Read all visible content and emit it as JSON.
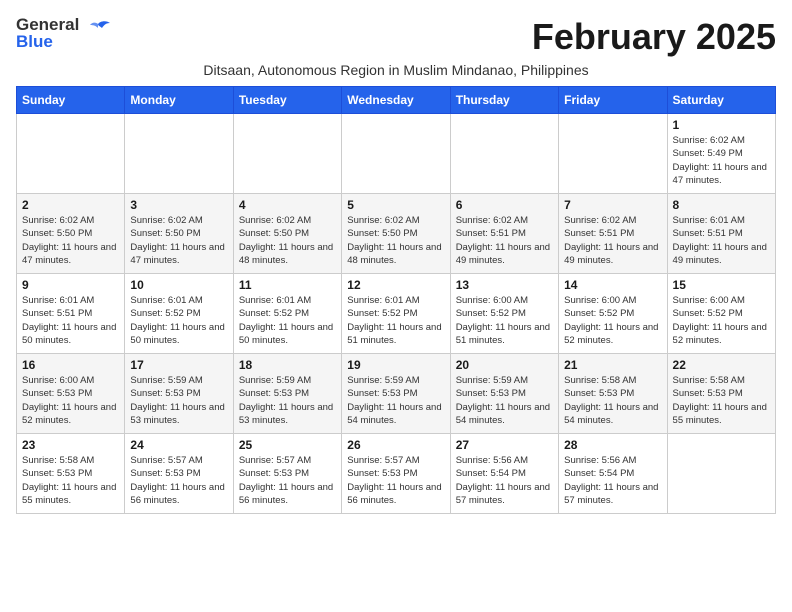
{
  "header": {
    "logo_general": "General",
    "logo_blue": "Blue",
    "month_title": "February 2025",
    "location": "Ditsaan, Autonomous Region in Muslim Mindanao, Philippines"
  },
  "days_of_week": [
    "Sunday",
    "Monday",
    "Tuesday",
    "Wednesday",
    "Thursday",
    "Friday",
    "Saturday"
  ],
  "weeks": [
    [
      {
        "day": "",
        "info": ""
      },
      {
        "day": "",
        "info": ""
      },
      {
        "day": "",
        "info": ""
      },
      {
        "day": "",
        "info": ""
      },
      {
        "day": "",
        "info": ""
      },
      {
        "day": "",
        "info": ""
      },
      {
        "day": "1",
        "info": "Sunrise: 6:02 AM\nSunset: 5:49 PM\nDaylight: 11 hours and 47 minutes."
      }
    ],
    [
      {
        "day": "2",
        "info": "Sunrise: 6:02 AM\nSunset: 5:50 PM\nDaylight: 11 hours and 47 minutes."
      },
      {
        "day": "3",
        "info": "Sunrise: 6:02 AM\nSunset: 5:50 PM\nDaylight: 11 hours and 47 minutes."
      },
      {
        "day": "4",
        "info": "Sunrise: 6:02 AM\nSunset: 5:50 PM\nDaylight: 11 hours and 48 minutes."
      },
      {
        "day": "5",
        "info": "Sunrise: 6:02 AM\nSunset: 5:50 PM\nDaylight: 11 hours and 48 minutes."
      },
      {
        "day": "6",
        "info": "Sunrise: 6:02 AM\nSunset: 5:51 PM\nDaylight: 11 hours and 49 minutes."
      },
      {
        "day": "7",
        "info": "Sunrise: 6:02 AM\nSunset: 5:51 PM\nDaylight: 11 hours and 49 minutes."
      },
      {
        "day": "8",
        "info": "Sunrise: 6:01 AM\nSunset: 5:51 PM\nDaylight: 11 hours and 49 minutes."
      }
    ],
    [
      {
        "day": "9",
        "info": "Sunrise: 6:01 AM\nSunset: 5:51 PM\nDaylight: 11 hours and 50 minutes."
      },
      {
        "day": "10",
        "info": "Sunrise: 6:01 AM\nSunset: 5:52 PM\nDaylight: 11 hours and 50 minutes."
      },
      {
        "day": "11",
        "info": "Sunrise: 6:01 AM\nSunset: 5:52 PM\nDaylight: 11 hours and 50 minutes."
      },
      {
        "day": "12",
        "info": "Sunrise: 6:01 AM\nSunset: 5:52 PM\nDaylight: 11 hours and 51 minutes."
      },
      {
        "day": "13",
        "info": "Sunrise: 6:00 AM\nSunset: 5:52 PM\nDaylight: 11 hours and 51 minutes."
      },
      {
        "day": "14",
        "info": "Sunrise: 6:00 AM\nSunset: 5:52 PM\nDaylight: 11 hours and 52 minutes."
      },
      {
        "day": "15",
        "info": "Sunrise: 6:00 AM\nSunset: 5:52 PM\nDaylight: 11 hours and 52 minutes."
      }
    ],
    [
      {
        "day": "16",
        "info": "Sunrise: 6:00 AM\nSunset: 5:53 PM\nDaylight: 11 hours and 52 minutes."
      },
      {
        "day": "17",
        "info": "Sunrise: 5:59 AM\nSunset: 5:53 PM\nDaylight: 11 hours and 53 minutes."
      },
      {
        "day": "18",
        "info": "Sunrise: 5:59 AM\nSunset: 5:53 PM\nDaylight: 11 hours and 53 minutes."
      },
      {
        "day": "19",
        "info": "Sunrise: 5:59 AM\nSunset: 5:53 PM\nDaylight: 11 hours and 54 minutes."
      },
      {
        "day": "20",
        "info": "Sunrise: 5:59 AM\nSunset: 5:53 PM\nDaylight: 11 hours and 54 minutes."
      },
      {
        "day": "21",
        "info": "Sunrise: 5:58 AM\nSunset: 5:53 PM\nDaylight: 11 hours and 54 minutes."
      },
      {
        "day": "22",
        "info": "Sunrise: 5:58 AM\nSunset: 5:53 PM\nDaylight: 11 hours and 55 minutes."
      }
    ],
    [
      {
        "day": "23",
        "info": "Sunrise: 5:58 AM\nSunset: 5:53 PM\nDaylight: 11 hours and 55 minutes."
      },
      {
        "day": "24",
        "info": "Sunrise: 5:57 AM\nSunset: 5:53 PM\nDaylight: 11 hours and 56 minutes."
      },
      {
        "day": "25",
        "info": "Sunrise: 5:57 AM\nSunset: 5:53 PM\nDaylight: 11 hours and 56 minutes."
      },
      {
        "day": "26",
        "info": "Sunrise: 5:57 AM\nSunset: 5:53 PM\nDaylight: 11 hours and 56 minutes."
      },
      {
        "day": "27",
        "info": "Sunrise: 5:56 AM\nSunset: 5:54 PM\nDaylight: 11 hours and 57 minutes."
      },
      {
        "day": "28",
        "info": "Sunrise: 5:56 AM\nSunset: 5:54 PM\nDaylight: 11 hours and 57 minutes."
      },
      {
        "day": "",
        "info": ""
      }
    ]
  ]
}
